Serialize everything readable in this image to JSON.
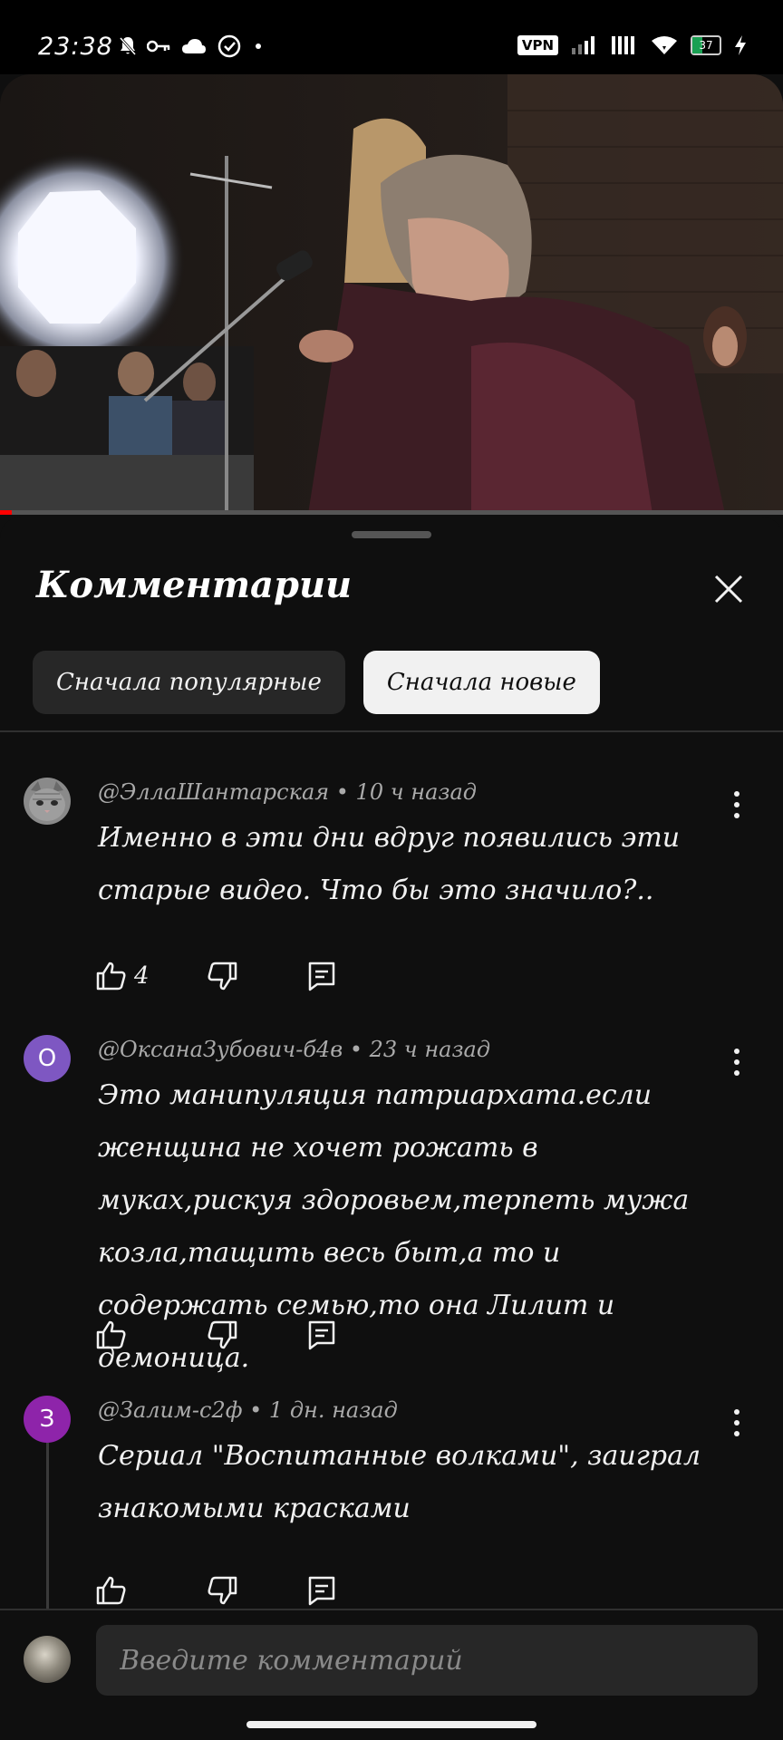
{
  "status_bar": {
    "time": "23:38",
    "vpn_label": "VPN",
    "battery_level": "37",
    "icons": [
      "bell-off-icon",
      "key-icon",
      "cloud-icon",
      "check-circle-icon",
      "dot-icon",
      "signal-icon",
      "signal-icon",
      "wifi-icon",
      "charging-icon"
    ]
  },
  "video": {
    "progress_fraction": 0.015,
    "progress_color": "#ff0000"
  },
  "comments_panel": {
    "title": "Комментарии",
    "close_icon": "close-icon",
    "sort_chips": [
      {
        "label": "Сначала популярные",
        "active": false
      },
      {
        "label": "Сначала новые",
        "active": true
      }
    ]
  },
  "comments": [
    {
      "author": "@ЭллаШантарская",
      "time": "10 ч назад",
      "meta": "@ЭллаШантарская • 10 ч назад",
      "text": "Именно в эти дни вдруг появились эти старые видео. Что бы это значило?..",
      "likes": "4",
      "avatar": {
        "type": "image",
        "icon": "cat-avatar-icon"
      }
    },
    {
      "author": "@ОксанаЗубович-б4в",
      "time": "23 ч назад",
      "meta": "@ОксанаЗубович-б4в • 23 ч назад",
      "text": "Это манипуляция патриархата.если женщина не хочет рожать в муках,рискуя здоровьем,терпеть мужа козла,тащить весь быт,а то и содержать семью,то она Лилит и демоница.",
      "likes": "",
      "avatar": {
        "type": "letter",
        "letter": "О",
        "color": "#7e57c2"
      }
    },
    {
      "author": "@Залим-с2ф",
      "time": "1 дн. назад",
      "meta": "@Залим-с2ф • 1 дн. назад",
      "text": "Сериал \"Воспитанные волками\", заиграл знакомыми красками",
      "likes": "",
      "avatar": {
        "type": "letter",
        "letter": "З",
        "color": "#8e24aa"
      }
    }
  ],
  "comment_input": {
    "placeholder": "Введите комментарий"
  },
  "colors": {
    "background": "#0f0f0f",
    "chip_bg": "#272727",
    "chip_active_bg": "#f1f1f1",
    "meta_text": "#aaaaaa"
  }
}
